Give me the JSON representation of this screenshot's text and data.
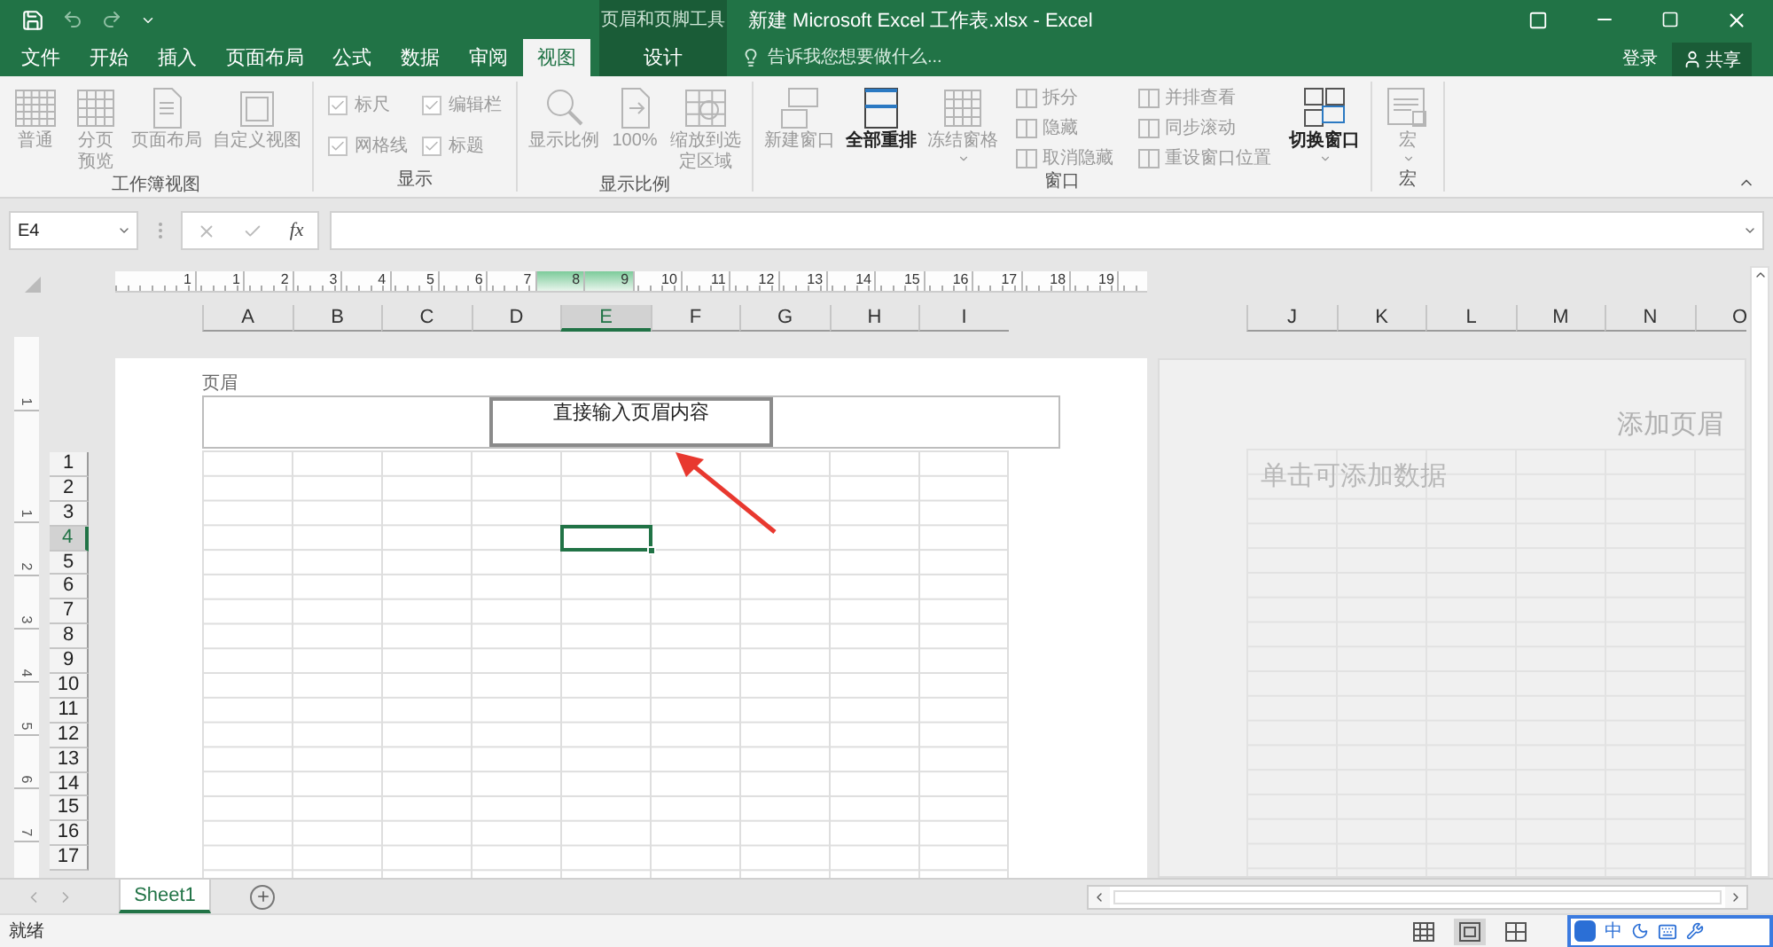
{
  "title_bar": {
    "contextual_label": "页眉和页脚工具",
    "title": "新建 Microsoft Excel 工作表.xlsx - Excel"
  },
  "tabs": [
    {
      "label": "文件",
      "selected": false,
      "kind": "normal"
    },
    {
      "label": "开始",
      "selected": false,
      "kind": "normal"
    },
    {
      "label": "插入",
      "selected": false,
      "kind": "normal"
    },
    {
      "label": "页面布局",
      "selected": false,
      "kind": "normal"
    },
    {
      "label": "公式",
      "selected": false,
      "kind": "normal"
    },
    {
      "label": "数据",
      "selected": false,
      "kind": "normal"
    },
    {
      "label": "审阅",
      "selected": false,
      "kind": "normal"
    },
    {
      "label": "视图",
      "selected": true,
      "kind": "normal"
    },
    {
      "label": "设计",
      "selected": false,
      "kind": "contextual"
    }
  ],
  "tell_me": {
    "placeholder": "告诉我您想要做什么..."
  },
  "account": {
    "sign_in": "登录",
    "share": "共享"
  },
  "ribbon_groups": [
    {
      "label": "工作簿视图",
      "items": [
        {
          "kind": "large",
          "label": "普通",
          "disabled": true,
          "dropdown": false
        },
        {
          "kind": "large_wrap",
          "label": "分页预览",
          "disabled": true,
          "dropdown": false
        },
        {
          "kind": "large",
          "label": "页面布局",
          "disabled": true,
          "dropdown": false
        },
        {
          "kind": "large",
          "label": "自定义视图",
          "disabled": true,
          "dropdown": false
        }
      ]
    },
    {
      "label": "显示",
      "items": [
        {
          "kind": "check",
          "label": "标尺",
          "checked": true,
          "disabled": true
        },
        {
          "kind": "check",
          "label": "编辑栏",
          "checked": true,
          "disabled": true
        },
        {
          "kind": "check",
          "label": "网格线",
          "checked": true,
          "disabled": true
        },
        {
          "kind": "check",
          "label": "标题",
          "checked": true,
          "disabled": true
        }
      ]
    },
    {
      "label": "显示比例",
      "items": [
        {
          "kind": "large",
          "label": "显示比例",
          "disabled": true,
          "dropdown": false
        },
        {
          "kind": "large",
          "label": "100%",
          "disabled": true,
          "dropdown": false
        },
        {
          "kind": "large_wrap",
          "label": "缩放到选定区域",
          "disabled": true,
          "dropdown": false
        }
      ]
    },
    {
      "label": "窗口",
      "items": [
        {
          "kind": "large",
          "label": "新建窗口",
          "disabled": true,
          "dropdown": false
        },
        {
          "kind": "large",
          "label": "全部重排",
          "disabled": false,
          "dropdown": false
        },
        {
          "kind": "large",
          "label": "冻结窗格",
          "disabled": true,
          "dropdown": true
        },
        {
          "kind": "small",
          "label": "拆分",
          "disabled": true
        },
        {
          "kind": "small",
          "label": "隐藏",
          "disabled": true
        },
        {
          "kind": "small",
          "label": "取消隐藏",
          "disabled": true
        },
        {
          "kind": "small",
          "label": "并排查看",
          "disabled": true
        },
        {
          "kind": "small",
          "label": "同步滚动",
          "disabled": true
        },
        {
          "kind": "small",
          "label": "重设窗口位置",
          "disabled": true
        },
        {
          "kind": "large",
          "label": "切换窗口",
          "disabled": false,
          "dropdown": true
        }
      ]
    },
    {
      "label": "宏",
      "items": [
        {
          "kind": "large",
          "label": "宏",
          "disabled": true,
          "dropdown": true
        }
      ]
    }
  ],
  "formula_bar": {
    "name_box": "E4",
    "function_label": "fx"
  },
  "ruler": {
    "marks": [
      {
        "label": "1",
        "selected": false
      },
      {
        "label": "1",
        "selected": false
      },
      {
        "label": "2",
        "selected": false
      },
      {
        "label": "3",
        "selected": false
      },
      {
        "label": "4",
        "selected": false
      },
      {
        "label": "5",
        "selected": false
      },
      {
        "label": "6",
        "selected": false
      },
      {
        "label": "7",
        "selected": false
      },
      {
        "label": "8",
        "selected": true
      },
      {
        "label": "9",
        "selected": true
      },
      {
        "label": "10",
        "selected": false
      },
      {
        "label": "11",
        "selected": false
      },
      {
        "label": "12",
        "selected": false
      },
      {
        "label": "13",
        "selected": false
      },
      {
        "label": "14",
        "selected": false
      },
      {
        "label": "15",
        "selected": false
      },
      {
        "label": "16",
        "selected": false
      },
      {
        "label": "17",
        "selected": false
      },
      {
        "label": "18",
        "selected": false
      },
      {
        "label": "19",
        "selected": false
      }
    ]
  },
  "vertical_ruler": [
    "1",
    "1",
    "2",
    "3",
    "4",
    "5",
    "6",
    "7"
  ],
  "columns": [
    {
      "label": "A",
      "selected": false
    },
    {
      "label": "B",
      "selected": false
    },
    {
      "label": "C",
      "selected": false
    },
    {
      "label": "D",
      "selected": false
    },
    {
      "label": "E",
      "selected": true
    },
    {
      "label": "F",
      "selected": false
    },
    {
      "label": "G",
      "selected": false
    },
    {
      "label": "H",
      "selected": false
    },
    {
      "label": "I",
      "selected": false
    }
  ],
  "right_columns": [
    "J",
    "K",
    "L",
    "M",
    "N",
    "O"
  ],
  "rows": [
    {
      "label": "1",
      "selected": false
    },
    {
      "label": "2",
      "selected": false
    },
    {
      "label": "3",
      "selected": false
    },
    {
      "label": "4",
      "selected": true
    },
    {
      "label": "5",
      "selected": false
    },
    {
      "label": "6",
      "selected": false
    },
    {
      "label": "7",
      "selected": false
    },
    {
      "label": "8",
      "selected": false
    },
    {
      "label": "9",
      "selected": false
    },
    {
      "label": "10",
      "selected": false
    },
    {
      "label": "11",
      "selected": false
    },
    {
      "label": "12",
      "selected": false
    },
    {
      "label": "13",
      "selected": false
    },
    {
      "label": "14",
      "selected": false
    },
    {
      "label": "15",
      "selected": false
    },
    {
      "label": "16",
      "selected": false
    },
    {
      "label": "17",
      "selected": false
    }
  ],
  "page": {
    "header_label": "页眉",
    "header_text": "直接输入页眉内容"
  },
  "next_page": {
    "header_hint": "添加页眉",
    "data_hint": "单击可添加数据"
  },
  "sheet_tabs": [
    {
      "label": "Sheet1",
      "selected": true
    }
  ],
  "status_bar": {
    "text": "就绪",
    "views": [
      {
        "selected": false
      },
      {
        "selected": true
      },
      {
        "selected": false
      }
    ]
  },
  "ime_toolbar": {
    "mode": "中"
  }
}
